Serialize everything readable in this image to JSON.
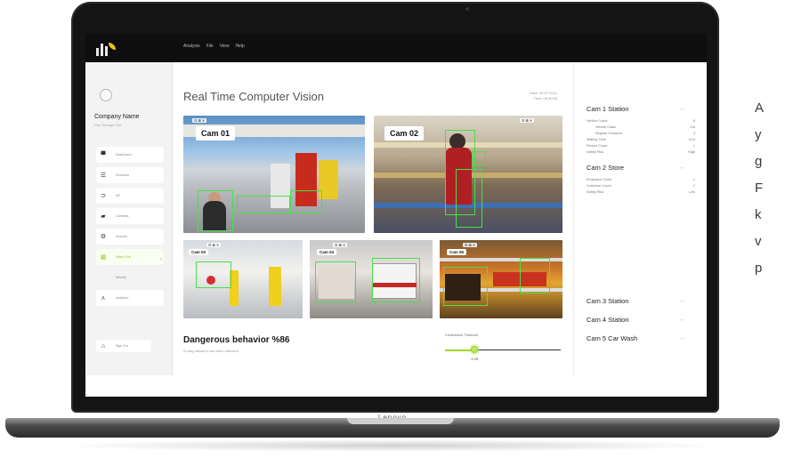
{
  "topbar": {
    "menu": [
      "Analysis",
      "File",
      "View",
      "Help"
    ]
  },
  "sidebar": {
    "company_name": "Company Name",
    "company_sub": "Gas Storage Fire",
    "items": [
      {
        "label": "Dashboard",
        "icon": "grid-icon",
        "glyph": "▀"
      },
      {
        "label": "Detection",
        "icon": "list-icon",
        "glyph": "☰"
      },
      {
        "label": "AR",
        "icon": "eye-icon",
        "glyph": "⊃"
      },
      {
        "label": "Cameras",
        "icon": "camera-icon",
        "glyph": "▰"
      },
      {
        "label": "Devices",
        "icon": "settings-icon",
        "glyph": "⚙"
      },
      {
        "label": "Video Grid",
        "icon": "grid-active-icon",
        "glyph": "▦"
      },
      {
        "label": "Weekly",
        "icon": "",
        "glyph": ""
      },
      {
        "label": "Analytics",
        "icon": "analytics-icon",
        "glyph": "⋏"
      }
    ],
    "footer_label": "Sign Out",
    "footer_glyph": "⌂"
  },
  "main": {
    "title": "Real Time Computer Vision",
    "date_line": "Date: 09.07.2021",
    "time_line": "Time: 08:30:58"
  },
  "cameras": [
    {
      "label": "Cam 01"
    },
    {
      "label": "Cam 02"
    },
    {
      "label": "Cam 03"
    },
    {
      "label": "Cam 04"
    },
    {
      "label": "Cam 05"
    }
  ],
  "camera_controls": "⊟ ⊠ ✕",
  "alert": {
    "title": "Dangerous behavior %86",
    "subtitle": "A risky situation has been detected"
  },
  "confidence": {
    "label": "Confidence Treshold",
    "value_text": "0.25",
    "value": 0.25
  },
  "right_panel": {
    "cam1": {
      "title": "Cam 1 Station",
      "caret": "‹ ›",
      "metrics": [
        {
          "label": "Vehicle Count",
          "value": "8",
          "indent": false
        },
        {
          "label": "Vehicle Class",
          "value": "Car",
          "indent": true
        },
        {
          "label": "Regular Customer",
          "value": "3",
          "indent": true
        },
        {
          "label": "Waiting Time",
          "value": "3:15",
          "indent": false
        },
        {
          "label": "Person Count",
          "value": "1",
          "indent": false
        },
        {
          "label": "Safety Risk",
          "value": "High",
          "indent": false
        }
      ]
    },
    "cam2": {
      "title": "Cam 2 Store",
      "caret": "‹ ›",
      "metrics": [
        {
          "label": "Employee Count",
          "value": "1"
        },
        {
          "label": "Costumer Count",
          "value": "2"
        },
        {
          "label": "Safety Risk",
          "value": "Low"
        }
      ]
    },
    "cam3": {
      "title": "Cam 3 Station",
      "caret": "‹ ›"
    },
    "cam4": {
      "title": "Cam 4 Station",
      "caret": "‹ ›"
    },
    "cam5": {
      "title": "Cam 5 Car Wash",
      "caret": "‹ ›"
    }
  },
  "laptop_label": "Lenovo",
  "side_text": "A\ny\ng\nF\nk\nv\np",
  "colors": {
    "accent": "#a4d62a",
    "bbox": "#49e04a",
    "topbar": "#0e0e0e"
  }
}
